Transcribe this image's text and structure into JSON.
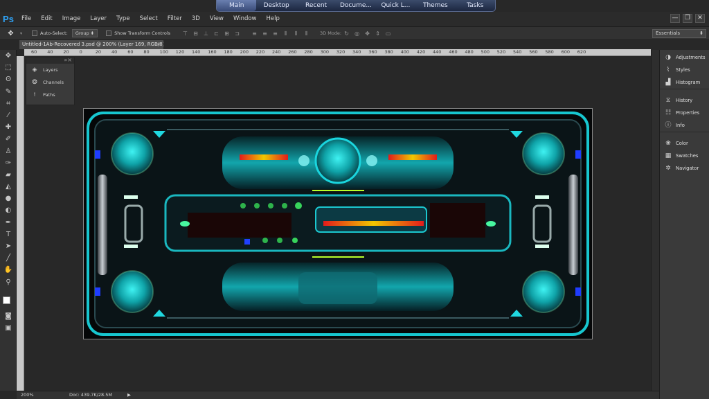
{
  "launcher": {
    "items": [
      "Main",
      "Desktop",
      "Recent",
      "Docume...",
      "Quick L...",
      "Themes",
      "Tasks"
    ]
  },
  "app": {
    "logo": "Ps"
  },
  "menubar": {
    "items": [
      "File",
      "Edit",
      "Image",
      "Layer",
      "Type",
      "Select",
      "Filter",
      "3D",
      "View",
      "Window",
      "Help"
    ]
  },
  "window_controls": {
    "minimize": "—",
    "restore": "❐",
    "close": "✕"
  },
  "options": {
    "auto_select": "Auto-Select:",
    "auto_select_value": "Group",
    "show_transform": "Show Transform Controls",
    "mode_3d": "3D Mode:",
    "workspace": "Essentials"
  },
  "document": {
    "tab_title": "Untitled-1Ab-Recovered 3.psd @ 200% (Layer 169, RGB/8) *",
    "close": "×",
    "ruler_ticks": [
      "60",
      "40",
      "20",
      "0",
      "20",
      "40",
      "60",
      "80",
      "100",
      "120",
      "140",
      "160",
      "180",
      "200",
      "220",
      "240",
      "260",
      "280",
      "300",
      "320",
      "340",
      "360",
      "380",
      "400",
      "420",
      "440",
      "460",
      "480",
      "500",
      "520",
      "540",
      "560",
      "580",
      "600",
      "620"
    ]
  },
  "mini_panel": {
    "items": [
      {
        "label": "Layers",
        "icon": "layers-icon"
      },
      {
        "label": "Channels",
        "icon": "channels-icon"
      },
      {
        "label": "Paths",
        "icon": "paths-icon"
      }
    ]
  },
  "right_panel": {
    "group1": [
      "Adjustments",
      "Styles",
      "Histogram"
    ],
    "group2": [
      "History",
      "Properties",
      "Info"
    ],
    "group3": [
      "Color",
      "Swatches",
      "Navigator"
    ]
  },
  "status": {
    "zoom": "200%",
    "doc": "Doc: 439.7K/28.5M",
    "arrow": "▶"
  },
  "colors": {
    "accent_teal": "#19c8d2",
    "ps_blue": "#2fa3f7",
    "ui_dark": "#282828"
  }
}
